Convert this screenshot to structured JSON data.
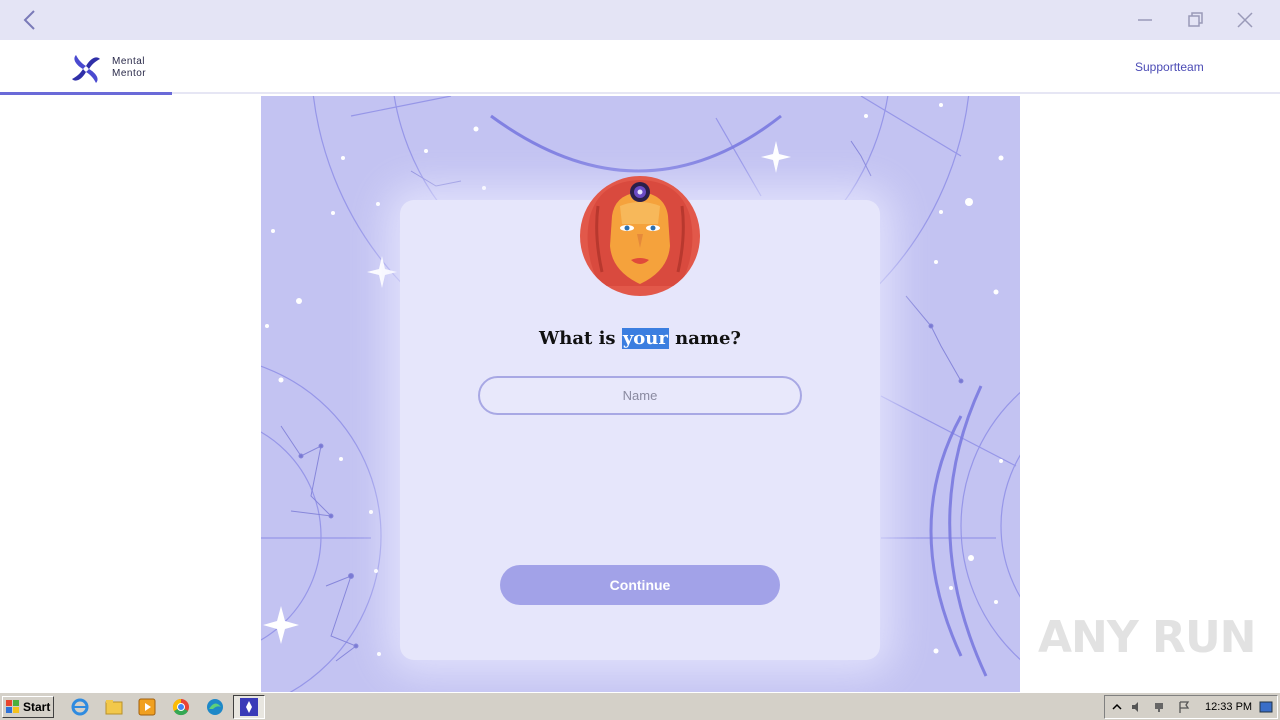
{
  "app": {
    "logo_line1": "Mental",
    "logo_line2": "Mentor",
    "support_label": "Supportteam",
    "brand_color": "#4b4bb5"
  },
  "onboarding": {
    "progress_fraction": 0.134,
    "question_before": "What is ",
    "question_highlight": "your",
    "question_after": " name?",
    "name_placeholder": "Name",
    "name_value": "",
    "continue_label": "Continue"
  },
  "window": {
    "back_icon": "chevron-left-icon",
    "minimize_icon": "minimize-icon",
    "restore_icon": "restore-icon",
    "close_icon": "close-icon"
  },
  "watermark": "ANY RUN",
  "taskbar": {
    "start_label": "Start",
    "clock": "12:33 PM",
    "pinned": [
      "internet-explorer-icon",
      "file-explorer-icon",
      "media-player-icon",
      "chrome-icon",
      "edge-icon",
      "mental-mentor-app-icon"
    ]
  }
}
